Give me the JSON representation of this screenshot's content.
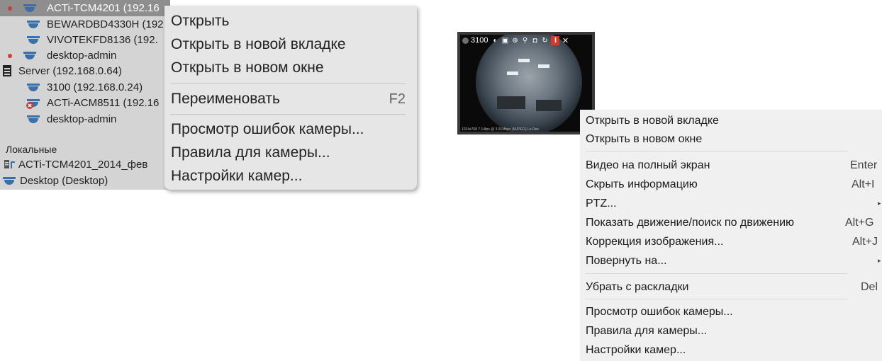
{
  "tree": {
    "items": [
      {
        "label": "ACTi-TCM4201 (192.16",
        "selected": true,
        "recording": true,
        "icon": "dome-camera-icon"
      },
      {
        "label": "BEWARDBD4330H (192",
        "icon": "dome-camera-icon"
      },
      {
        "label": "VIVOTEKFD8136 (192.",
        "icon": "dome-camera-icon"
      },
      {
        "label": "desktop-admin",
        "recording": true,
        "icon": "dome-camera-icon"
      },
      {
        "label": "Server (192.168.0.64)",
        "icon": "server-icon"
      },
      {
        "label": "3100 (192.168.0.24)",
        "icon": "dome-camera-icon"
      },
      {
        "label": "ACTi-ACM8511 (192.16",
        "icon": "camera-error-icon"
      },
      {
        "label": "desktop-admin",
        "icon": "dome-camera-icon"
      },
      {
        "label": "Локальные"
      },
      {
        "label": "ACTi-TCM4201_2014_фев",
        "icon": "local-file-icon"
      },
      {
        "label": "Desktop (Desktop)",
        "icon": "dome-camera-icon"
      }
    ]
  },
  "menu_left": {
    "items": [
      {
        "label": "Открыть"
      },
      {
        "label": "Открыть в новой вкладке"
      },
      {
        "label": "Открыть в новом окне"
      },
      {
        "label": "Переименовать",
        "shortcut": "F2"
      },
      {
        "label": "Просмотр ошибок камеры..."
      },
      {
        "label": "Правила для камеры..."
      },
      {
        "label": "Настройки камер..."
      }
    ]
  },
  "camera_tile": {
    "name": "3100",
    "status_text": "1024x768 7.14fps @ 3.91Mbps (MJPEG) Lo-Res"
  },
  "menu_right": {
    "items": [
      {
        "label": "Открыть в новой вкладке"
      },
      {
        "label": "Открыть в новом окне"
      },
      {
        "label": "Видео на полный экран",
        "shortcut": "Enter"
      },
      {
        "label": "Скрыть информацию",
        "shortcut": "Alt+I"
      },
      {
        "label": "PTZ...",
        "submenu": true
      },
      {
        "label": "Показать движение/поиск по движению",
        "shortcut": "Alt+G"
      },
      {
        "label": "Коррекция изображения...",
        "shortcut": "Alt+J"
      },
      {
        "label": "Повернуть на...",
        "submenu": true
      },
      {
        "label": "Убрать с раскладки",
        "shortcut": "Del"
      },
      {
        "label": "Просмотр ошибок камеры..."
      },
      {
        "label": "Правила для камеры..."
      },
      {
        "label": "Настройки камер..."
      }
    ]
  },
  "colors": {
    "selection": "#8e8e8e",
    "recording_dot": "#d43a3a",
    "info_button": "#d23a2a",
    "camera_icon": "#3a6fa8"
  }
}
